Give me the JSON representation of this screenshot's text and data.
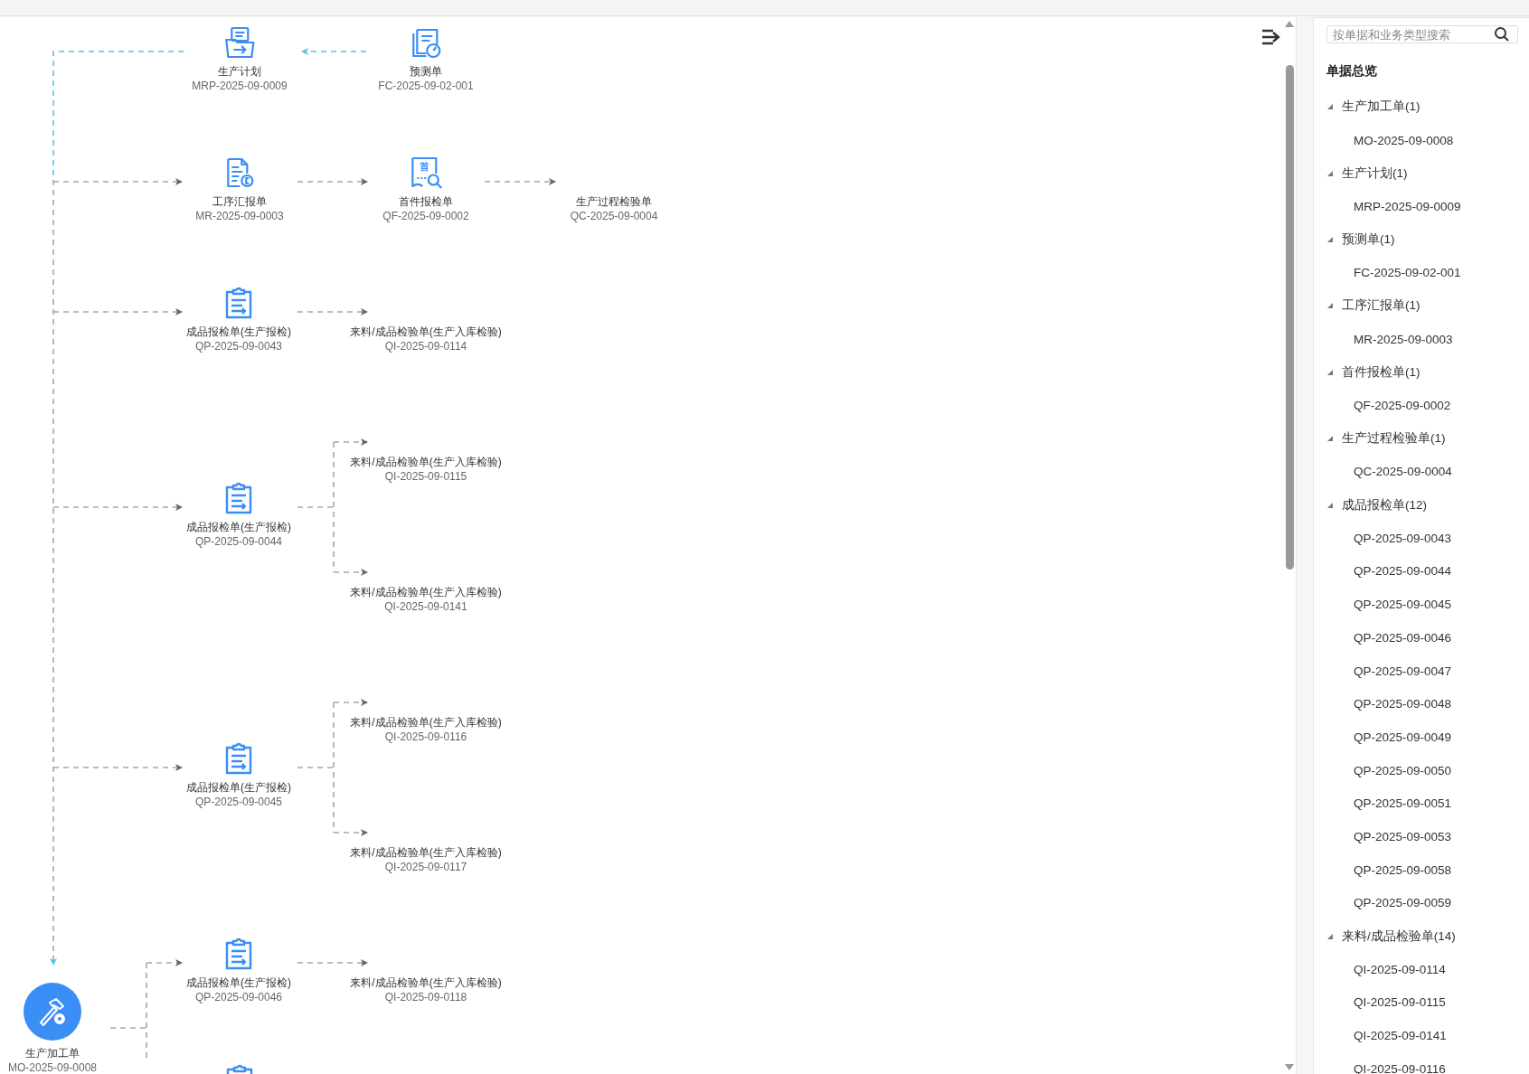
{
  "diagram": {
    "nodes": [
      {
        "kind": "plan",
        "label": "生产计划",
        "code": "MRP-2025-09-0009"
      },
      {
        "kind": "forecast",
        "label": "预测单",
        "code": "FC-2025-09-02-001"
      },
      {
        "kind": "report",
        "label": "工序汇报单",
        "code": "MR-2025-09-0003"
      },
      {
        "kind": "first-inspection",
        "icon_text": "首",
        "label": "首件报检单",
        "code": "QF-2025-09-0002"
      },
      {
        "kind": "plain",
        "label": "生产过程检验单",
        "code": "QC-2025-09-0004"
      },
      {
        "kind": "clipboard",
        "label": "成品报检单(生产报检)",
        "code": "QP-2025-09-0043"
      },
      {
        "kind": "plain",
        "label": "来料/成品检验单(生产入库检验)",
        "code": "QI-2025-09-0114"
      },
      {
        "kind": "clipboard",
        "label": "成品报检单(生产报检)",
        "code": "QP-2025-09-0044"
      },
      {
        "kind": "plain",
        "label": "来料/成品检验单(生产入库检验)",
        "code": "QI-2025-09-0115"
      },
      {
        "kind": "plain",
        "label": "来料/成品检验单(生产入库检验)",
        "code": "QI-2025-09-0141"
      },
      {
        "kind": "clipboard",
        "label": "成品报检单(生产报检)",
        "code": "QP-2025-09-0045"
      },
      {
        "kind": "plain",
        "label": "来料/成品检验单(生产入库检验)",
        "code": "QI-2025-09-0116"
      },
      {
        "kind": "plain",
        "label": "来料/成品检验单(生产入库检验)",
        "code": "QI-2025-09-0117"
      },
      {
        "kind": "clipboard",
        "label": "成品报检单(生产报检)",
        "code": "QP-2025-09-0046"
      },
      {
        "kind": "plain",
        "label": "来料/成品检验单(生产入库检验)",
        "code": "QI-2025-09-0118"
      },
      {
        "kind": "clipboard"
      },
      {
        "kind": "main",
        "label": "生产加工单",
        "code": "MO-2025-09-0008"
      }
    ]
  },
  "sidebar": {
    "search": {
      "placeholder": "按单据和业务类型搜索"
    },
    "heading": "单据总览",
    "groups": [
      {
        "label": "生产加工单(1)",
        "expanded": true,
        "children": [
          "MO-2025-09-0008"
        ]
      },
      {
        "label": "生产计划(1)",
        "expanded": true,
        "children": [
          "MRP-2025-09-0009"
        ]
      },
      {
        "label": "预测单(1)",
        "expanded": true,
        "children": [
          "FC-2025-09-02-001"
        ]
      },
      {
        "label": "工序汇报单(1)",
        "expanded": true,
        "children": [
          "MR-2025-09-0003"
        ]
      },
      {
        "label": "首件报检单(1)",
        "expanded": true,
        "children": [
          "QF-2025-09-0002"
        ]
      },
      {
        "label": "生产过程检验单(1)",
        "expanded": true,
        "children": [
          "QC-2025-09-0004"
        ]
      },
      {
        "label": "成品报检单(12)",
        "expanded": true,
        "children": [
          "QP-2025-09-0043",
          "QP-2025-09-0044",
          "QP-2025-09-0045",
          "QP-2025-09-0046",
          "QP-2025-09-0047",
          "QP-2025-09-0048",
          "QP-2025-09-0049",
          "QP-2025-09-0050",
          "QP-2025-09-0051",
          "QP-2025-09-0053",
          "QP-2025-09-0058",
          "QP-2025-09-0059"
        ]
      },
      {
        "label": "来料/成品检验单(14)",
        "expanded": true,
        "children": [
          "QI-2025-09-0114",
          "QI-2025-09-0115",
          "QI-2025-09-0141",
          "QI-2025-09-0116"
        ]
      }
    ]
  }
}
